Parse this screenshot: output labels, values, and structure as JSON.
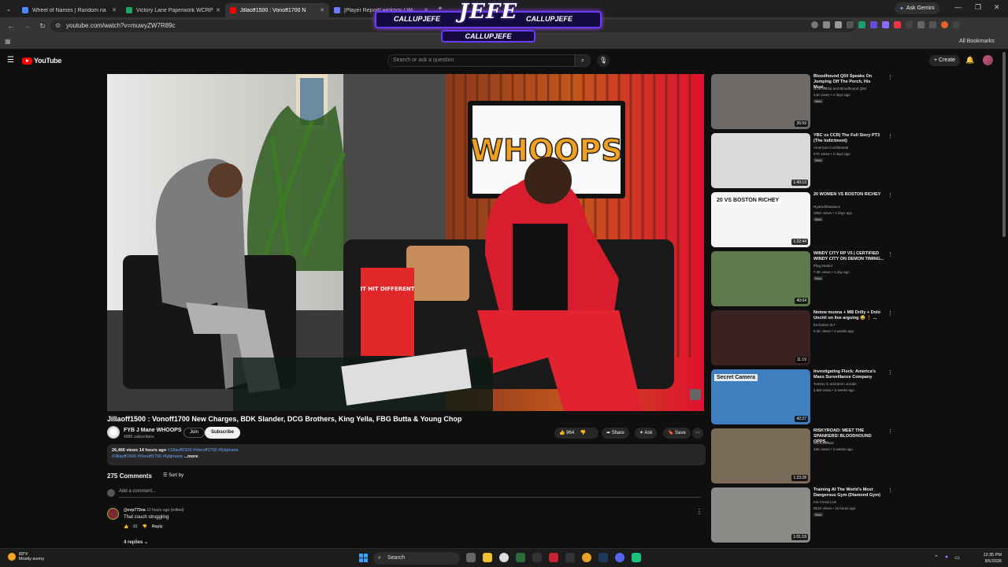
{
  "browser": {
    "tabs": [
      {
        "title": "Wheel of Names | Random na",
        "color": "#4a8cff"
      },
      {
        "title": "Victory Lane Paperwork WCRP",
        "color": "#1fa463"
      },
      {
        "title": "Jillaoff1500 : Vonoff1700 N",
        "color": "#ff0000"
      },
      {
        "title": "[Player Report] wickpov | Wi",
        "color": "#6a7cff"
      }
    ],
    "new_tab": "+",
    "ask_gemini": "Ask Gemini",
    "url": "youtube.com/watch?v=muwyZW7R89c",
    "bookmarks_label": "All Bookmarks"
  },
  "overlay": {
    "logo": "JEFE",
    "handle_left": "CALLUPJEFE",
    "handle_right": "CALLUPJEFE",
    "handle_bottom": "CALLUPJEFE"
  },
  "youtube": {
    "logo_text": "YouTube",
    "search_placeholder": "Search or ask a question",
    "create_label": "Create"
  },
  "video": {
    "title": "Jillaoff1500 : Vonoff1700 New Charges, BDK Slander, DCG Brothers, King Yella, FBG Butta & Young Chop",
    "channel": "FYB J Mane WHOOPS",
    "subscribers": "498K subscribers",
    "join_label": "Join",
    "subscribe_label": "Subscribe",
    "likes": "964",
    "share_label": "Share",
    "ask_label": "Ask",
    "save_label": "Save",
    "scene_sign": "WHOOPS",
    "scene_box_text": "IT HIT DIFFERENT",
    "description": {
      "meta": "26,466 views  14 hours ago",
      "tags_line1": " #Jillaoff1500 #Vonoff1700 #fybjmane",
      "tags_line2": "#Jillaoff1500 #Vonoff1700 #fybjmane",
      "more": "...more"
    }
  },
  "comments": {
    "count_label": "275 Comments",
    "sort_label": "Sort by",
    "add_placeholder": "Add a comment...",
    "items": [
      {
        "user": "@evp773na",
        "time": "13 hours ago (edited)",
        "text": "That couch struggling",
        "likes": "81",
        "reply_label": "Reply",
        "replies_label": "4 replies"
      }
    ]
  },
  "recommendations": [
    {
      "title": "Bloodhound Q50 Speaks On Jumping Off The Porch, His Musi...",
      "channel": "DOB Media and Bloodhound Q50",
      "views": "44K views • 4 days ago",
      "badge": "New",
      "duration": "26:59",
      "bg": "#6d6a68"
    },
    {
      "title": "YBC vs CCR| The Full Story PT3 (The Indictment)",
      "channel": "American Confidential",
      "views": "57K views • 2 days ago",
      "badge": "New",
      "duration": "1:40:13",
      "bg": "#d9d9d9"
    },
    {
      "title": "20 WOMEN VS BOSTON RICHEY",
      "channel": "Ryanwithlasauce",
      "views": "185K views • 2 days ago",
      "badge": "New",
      "duration": "1:22:44",
      "bg": "#f4f4f4",
      "thumb_text": "20 VS BOSTON RICHEY"
    },
    {
      "title": "WINDY CITY RP V5 | CERTIFIED WINDY CITY ON DEMON TIMING...",
      "channel": "Plug Mutant",
      "views": "7.3K views • 1 day ago",
      "badge": "New",
      "duration": "40:04",
      "bg": "#5f7a4c"
    },
    {
      "title": "Notow munna + MB Drilly + Dolo Unchil on live arguing 😂 ❗ ...",
      "channel": "Exclusive SLT",
      "views": "6.3K views • 4 weeks ago",
      "badge": "",
      "duration": "11:19",
      "bg": "#3a2222"
    },
    {
      "title": "Investigating Flock: America's Mass Surveillance Company",
      "channel": "Tommy G and Benn Jordan",
      "views": "3.6M views • 2 weeks ago",
      "badge": "",
      "duration": "42:27",
      "bg": "#3f7fc0",
      "thumb_text": "Secret Camera"
    },
    {
      "title": "RISKYROAD: MEET THE SPANKERS! BLOODHOUND OPPS...",
      "channel": "Swordsblade",
      "views": "45K views • 3 weeks ago",
      "badge": "",
      "duration": "1:23:28",
      "bg": "#7a6a58"
    },
    {
      "title": "Training At The World's Most Dangerous Gym (Diamond Gym)",
      "channel": "Kai Cenat Live",
      "views": "961K views • 16 hours ago",
      "badge": "New",
      "duration": "1:01:19",
      "bg": "#8a8a86"
    }
  ],
  "taskbar": {
    "temperature": "83°F",
    "weather": "Mostly sunny",
    "search_label": "Search",
    "time": "12:35 PM",
    "date": "8/5/2026"
  }
}
